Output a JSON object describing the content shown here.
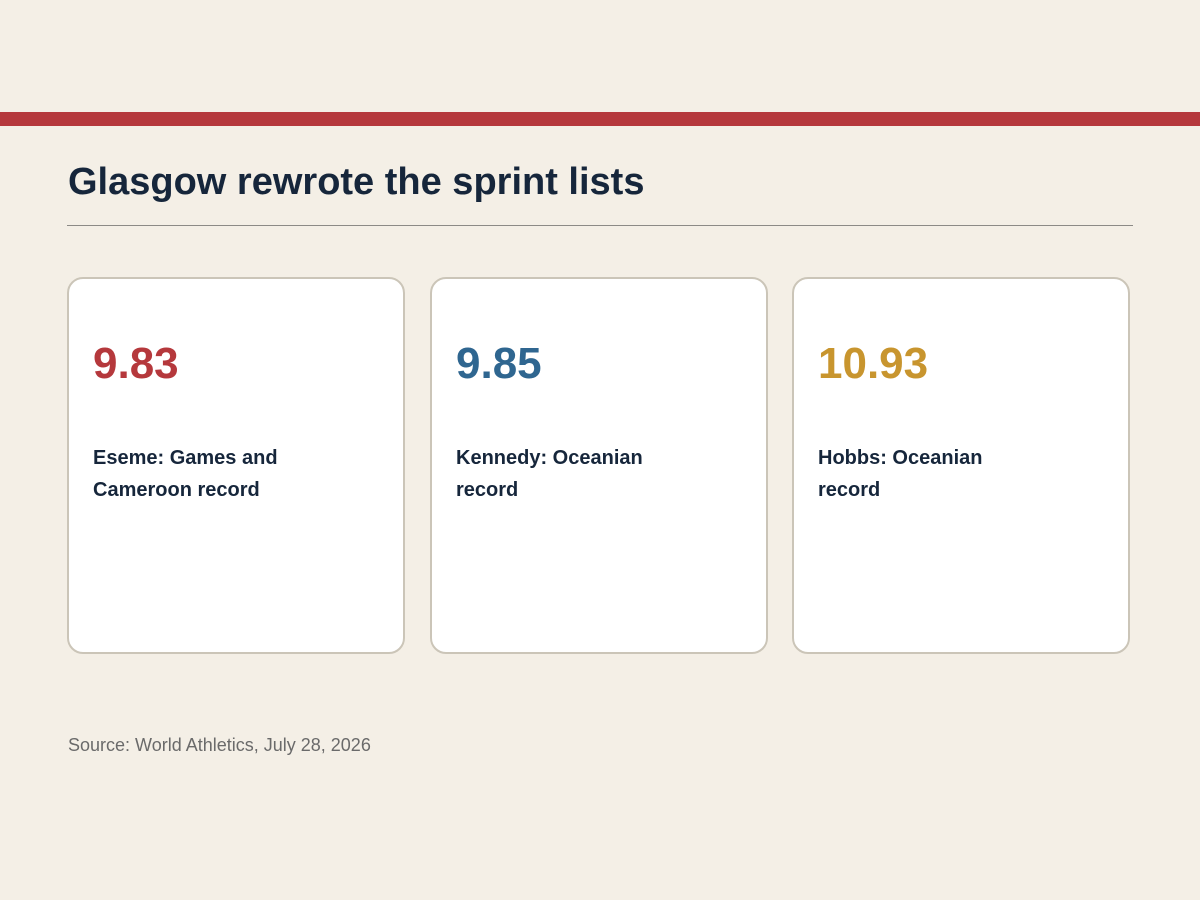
{
  "colors": {
    "background": "#f4efe6",
    "accent_bar": "#b5383c",
    "title_text": "#16263b",
    "card_border": "#cbc5b8",
    "source_text": "#6a6a6a"
  },
  "title": "Glasgow rewrote the sprint lists",
  "cards": [
    {
      "value": "9.83",
      "label": "Eseme: Games and Cameroon record",
      "color": "#b5383c"
    },
    {
      "value": "9.85",
      "label": "Kennedy: Oceanian record",
      "color": "#2f6690"
    },
    {
      "value": "10.93",
      "label": "Hobbs: Oceanian record",
      "color": "#c8952e"
    }
  ],
  "source": "Source: World Athletics, July 28, 2026"
}
